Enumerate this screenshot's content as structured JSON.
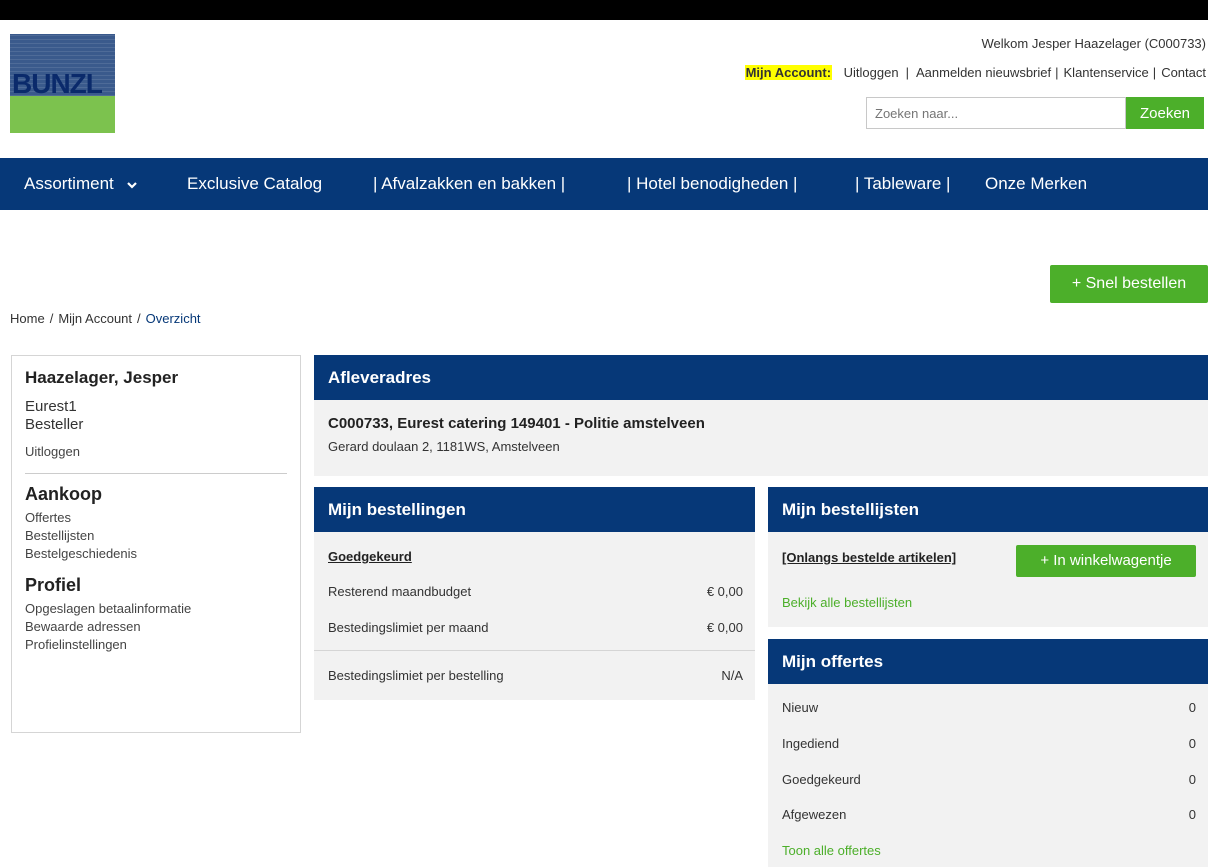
{
  "header": {
    "logo_text": "BUNZL",
    "welcome": "Welkom Jesper Haazelager (C000733)",
    "account_label": "Mijn Account:",
    "links": [
      "Uitloggen",
      "Aanmelden nieuwsbrief",
      "Klantenservice",
      "Contact"
    ],
    "search_placeholder": "Zoeken naar...",
    "search_button": "Zoeken"
  },
  "nav": {
    "items": [
      "Assortiment",
      "Exclusive Catalog",
      "| Afvalzakken en bakken |",
      "| Hotel benodigheden |",
      "| Tableware |",
      "Onze Merken"
    ]
  },
  "quick_order": "+ Snel bestellen",
  "breadcrumb": [
    "Home",
    "Mijn Account",
    "Overzicht"
  ],
  "sidebar": {
    "name": "Haazelager, Jesper",
    "company": "Eurest1",
    "role": "Besteller",
    "logout": "Uitloggen",
    "purchase_title": "Aankoop",
    "purchase_items": [
      "Offertes",
      "Bestellijsten",
      "Bestelgeschiedenis"
    ],
    "profile_title": "Profiel",
    "profile_items": [
      "Opgeslagen betaalinformatie",
      "Bewaarde adressen",
      "Profielinstellingen"
    ]
  },
  "address": {
    "title": "Afleveradres",
    "name": "C000733, Eurest catering 149401 - Politie amstelveen",
    "street": "Gerard doulaan 2, 1181WS, Amstelveen"
  },
  "orders": {
    "title": "Mijn bestellingen",
    "status_link": "Goedgekeurd",
    "rows": [
      {
        "label": "Resterend maandbudget",
        "value": "€ 0,00"
      },
      {
        "label": "Bestedingslimiet per maand",
        "value": "€ 0,00"
      },
      {
        "label": "Bestedingslimiet per bestelling",
        "value": "N/A"
      }
    ]
  },
  "lists": {
    "title": "Mijn bestellijsten",
    "recent_link": "[Onlangs bestelde artikelen]",
    "cart_button": "+ In winkelwagentje",
    "view_all": "Bekijk alle bestellijsten"
  },
  "quotes": {
    "title": "Mijn offertes",
    "rows": [
      {
        "label": "Nieuw",
        "value": "0"
      },
      {
        "label": "Ingediend",
        "value": "0"
      },
      {
        "label": "Goedgekeurd",
        "value": "0"
      },
      {
        "label": "Afgewezen",
        "value": "0"
      }
    ],
    "show_all": "Toon alle offertes"
  }
}
